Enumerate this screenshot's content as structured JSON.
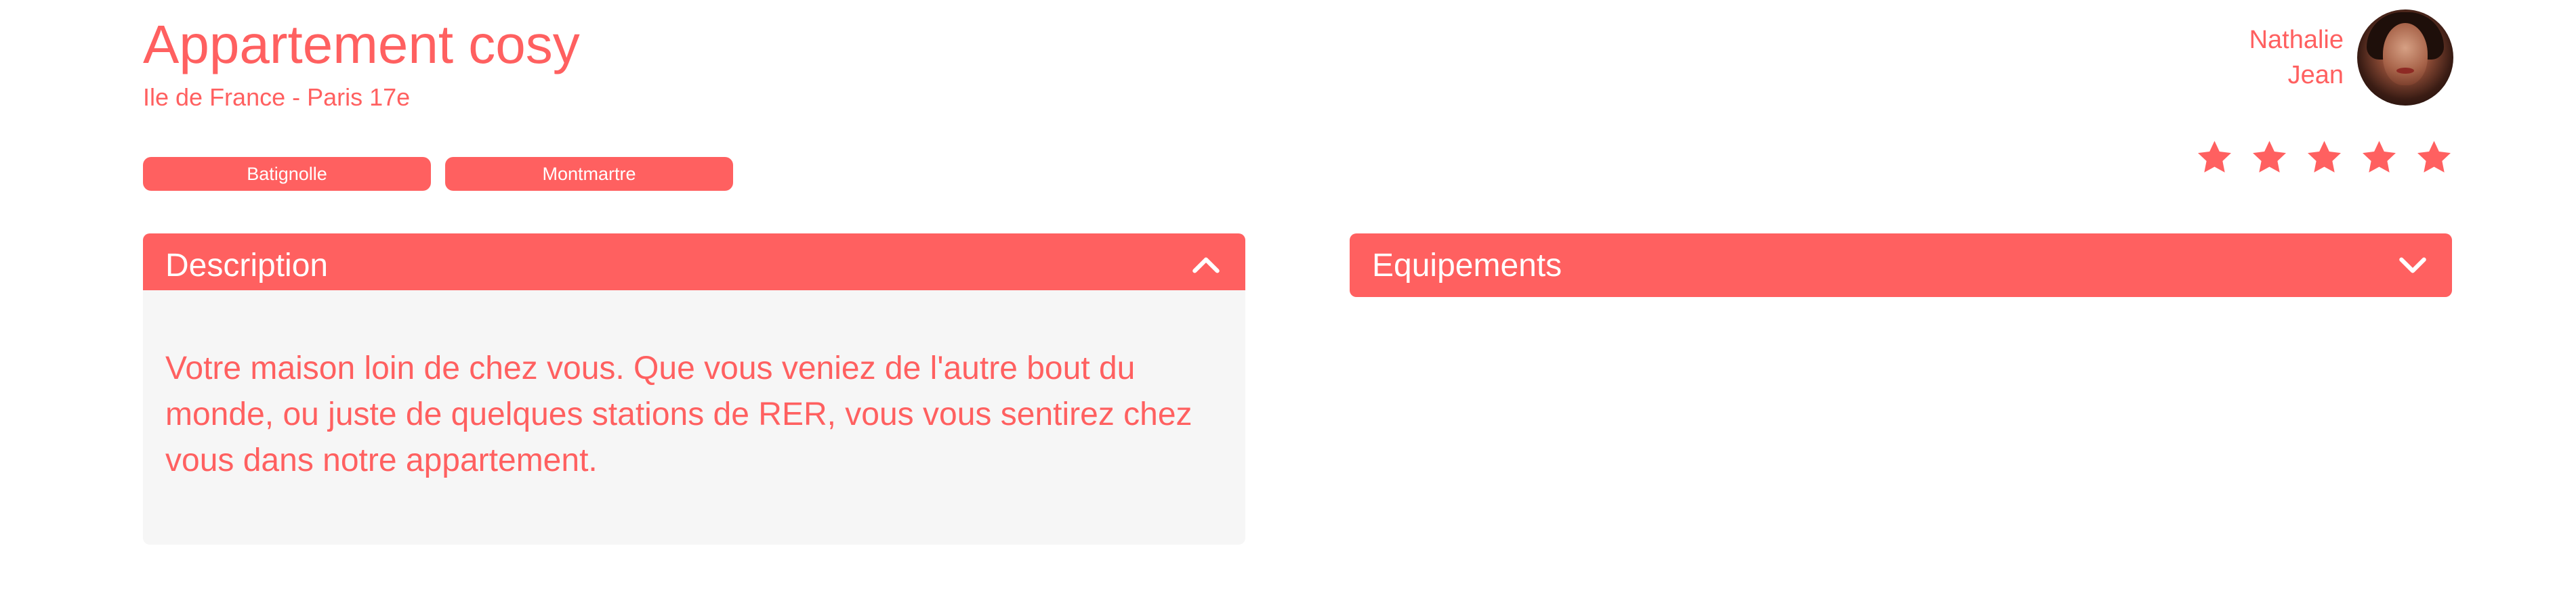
{
  "listing": {
    "title": "Appartement cosy",
    "location": "Ile de France - Paris 17e",
    "tags": [
      "Batignolle",
      "Montmartre"
    ]
  },
  "host": {
    "first_name": "Nathalie",
    "last_name": "Jean"
  },
  "rating": {
    "value": 5,
    "max": 5
  },
  "collapses": {
    "description": {
      "label": "Description",
      "expanded": true,
      "content": "Votre maison loin de chez vous. Que vous veniez de l'autre bout du monde, ou juste de quelques stations de RER, vous vous sentirez chez vous dans notre appartement."
    },
    "equipements": {
      "label": "Equipements",
      "expanded": false
    }
  },
  "colors": {
    "accent": "#FF6060",
    "panel_bg": "#F6F6F6",
    "text_on_accent": "#FFFFFF"
  },
  "icons": {
    "star": "star-icon",
    "chevron_up": "chevron-up-icon",
    "chevron_down": "chevron-down-icon"
  }
}
